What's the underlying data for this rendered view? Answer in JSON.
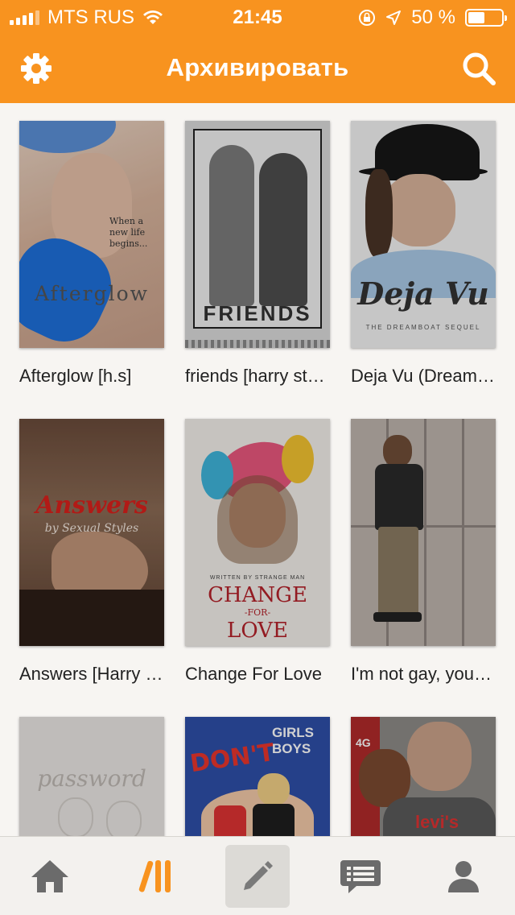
{
  "status_bar": {
    "carrier": "MTS RUS",
    "time": "21:45",
    "battery": "50 %",
    "battery_level": 0.5,
    "icons": [
      "signal-icon",
      "wifi-icon",
      "rotation-lock-icon",
      "location-icon",
      "battery-icon"
    ]
  },
  "header": {
    "title": "Архивировать",
    "left_icon": "gear-icon",
    "right_icon": "search-icon",
    "background": "#f8931f"
  },
  "stories": [
    {
      "title": "Afterglow [h.s]",
      "cover_text": "Afterglow",
      "cover_subtext": "When a new life begins..."
    },
    {
      "title": "friends [harry styles]",
      "cover_text": "FRIENDS",
      "cover_subtext": ""
    },
    {
      "title": "Deja Vu (Dreamboat sequel)",
      "cover_text": "Deja Vu",
      "cover_subtext": "THE DREAMBOAT SEQUEL"
    },
    {
      "title": "Answers [Harry Styles]",
      "cover_text": "Answers",
      "cover_subtext": "by Sexual Styles"
    },
    {
      "title": "Change For Love",
      "cover_text": "CHANGE",
      "cover_subtext": "-FOR-",
      "cover_text2": "LOVE",
      "cover_top": "WRITTEN BY STRANGE MAN"
    },
    {
      "title": "I'm not gay, you are",
      "cover_text": "",
      "cover_subtext": ""
    },
    {
      "title": "",
      "cover_text": "password",
      "cover_subtext": ""
    },
    {
      "title": "",
      "cover_text": "DON'T",
      "cover_subtext": "GIRLS BOYS"
    },
    {
      "title": "",
      "cover_text": "levi's",
      "cover_subtext": "4G"
    }
  ],
  "tabbar": {
    "tabs": [
      {
        "name": "home",
        "icon": "home-icon"
      },
      {
        "name": "library",
        "icon": "library-icon",
        "active": true
      },
      {
        "name": "write",
        "icon": "pencil-icon"
      },
      {
        "name": "messages",
        "icon": "messages-icon"
      },
      {
        "name": "profile",
        "icon": "profile-icon"
      }
    ]
  },
  "colors": {
    "accent": "#f8931f",
    "tab_icon": "#6b6b6b"
  }
}
